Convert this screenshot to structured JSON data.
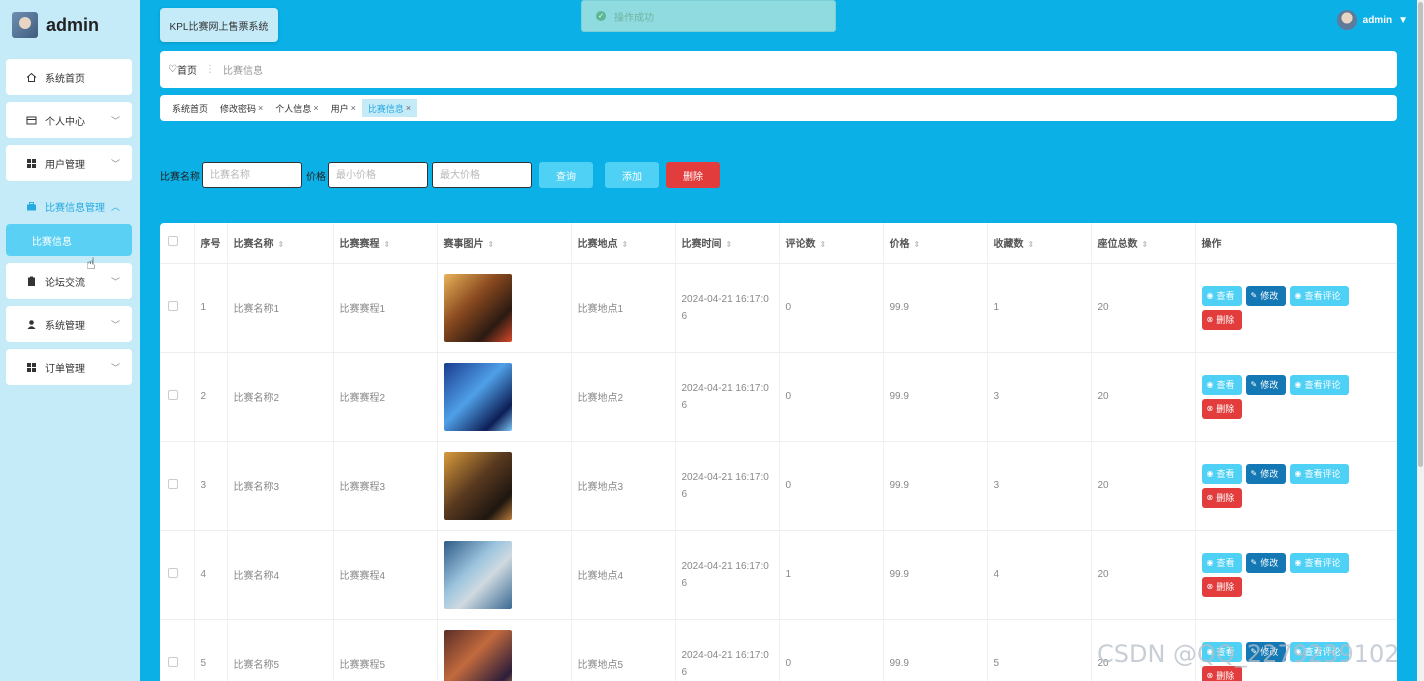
{
  "brand": {
    "name": "admin"
  },
  "sidebar": {
    "items": [
      {
        "label": "系统首页",
        "icon": "home-icon",
        "expandable": false
      },
      {
        "label": "个人中心",
        "icon": "card-icon",
        "expandable": true
      },
      {
        "label": "用户管理",
        "icon": "grid-icon",
        "expandable": true
      },
      {
        "label": "比赛信息管理",
        "icon": "briefcase-icon",
        "expandable": true,
        "active": true
      },
      {
        "label": "论坛交流",
        "icon": "clipboard-icon",
        "expandable": true
      },
      {
        "label": "系统管理",
        "icon": "user-icon",
        "expandable": true
      },
      {
        "label": "订单管理",
        "icon": "grid-icon",
        "expandable": true
      }
    ],
    "submenu_active": "比赛信息"
  },
  "header": {
    "system_title": "KPL比赛网上售票系统",
    "toast": "操作成功",
    "user": "admin"
  },
  "breadcrumb": {
    "home": "首页",
    "current": "比赛信息"
  },
  "tags": [
    {
      "label": "系统首页",
      "closable": false
    },
    {
      "label": "修改密码",
      "closable": true
    },
    {
      "label": "个人信息",
      "closable": true
    },
    {
      "label": "用户",
      "closable": true
    },
    {
      "label": "比赛信息",
      "closable": true,
      "active": true
    }
  ],
  "search": {
    "name_label": "比赛名称",
    "name_placeholder": "比赛名称",
    "price_label": "价格",
    "min_placeholder": "最小价格",
    "max_placeholder": "最大价格",
    "query": "查询",
    "add": "添加",
    "delete": "删除"
  },
  "table": {
    "columns": [
      "序号",
      "比赛名称",
      "比赛赛程",
      "赛事图片",
      "比赛地点",
      "比赛时间",
      "评论数",
      "价格",
      "收藏数",
      "座位总数",
      "操作"
    ],
    "rows": [
      {
        "no": "1",
        "name": "比赛名称1",
        "schedule": "比赛赛程1",
        "place": "比赛地点1",
        "time": "2024-04-21 16:17:06",
        "comments": "0",
        "price": "99.9",
        "favorites": "1",
        "seats": "20"
      },
      {
        "no": "2",
        "name": "比赛名称2",
        "schedule": "比赛赛程2",
        "place": "比赛地点2",
        "time": "2024-04-21 16:17:06",
        "comments": "0",
        "price": "99.9",
        "favorites": "3",
        "seats": "20"
      },
      {
        "no": "3",
        "name": "比赛名称3",
        "schedule": "比赛赛程3",
        "place": "比赛地点3",
        "time": "2024-04-21 16:17:06",
        "comments": "0",
        "price": "99.9",
        "favorites": "3",
        "seats": "20"
      },
      {
        "no": "4",
        "name": "比赛名称4",
        "schedule": "比赛赛程4",
        "place": "比赛地点4",
        "time": "2024-04-21 16:17:06",
        "comments": "1",
        "price": "99.9",
        "favorites": "4",
        "seats": "20"
      },
      {
        "no": "5",
        "name": "比赛名称5",
        "schedule": "比赛赛程5",
        "place": "比赛地点5",
        "time": "2024-04-21 16:17:06",
        "comments": "0",
        "price": "99.9",
        "favorites": "5",
        "seats": "20"
      }
    ],
    "actions": {
      "view": "查看",
      "edit": "修改",
      "comments": "查看评论",
      "delete": "删除"
    }
  },
  "watermark": "CSDN @QQ_2279239102",
  "colors": {
    "sidebar_bg": "#c6ebf8",
    "main_bg": "#0ab0e6",
    "accent": "#4fd0f5",
    "danger": "#e23c3c",
    "edit": "#1478b4"
  }
}
